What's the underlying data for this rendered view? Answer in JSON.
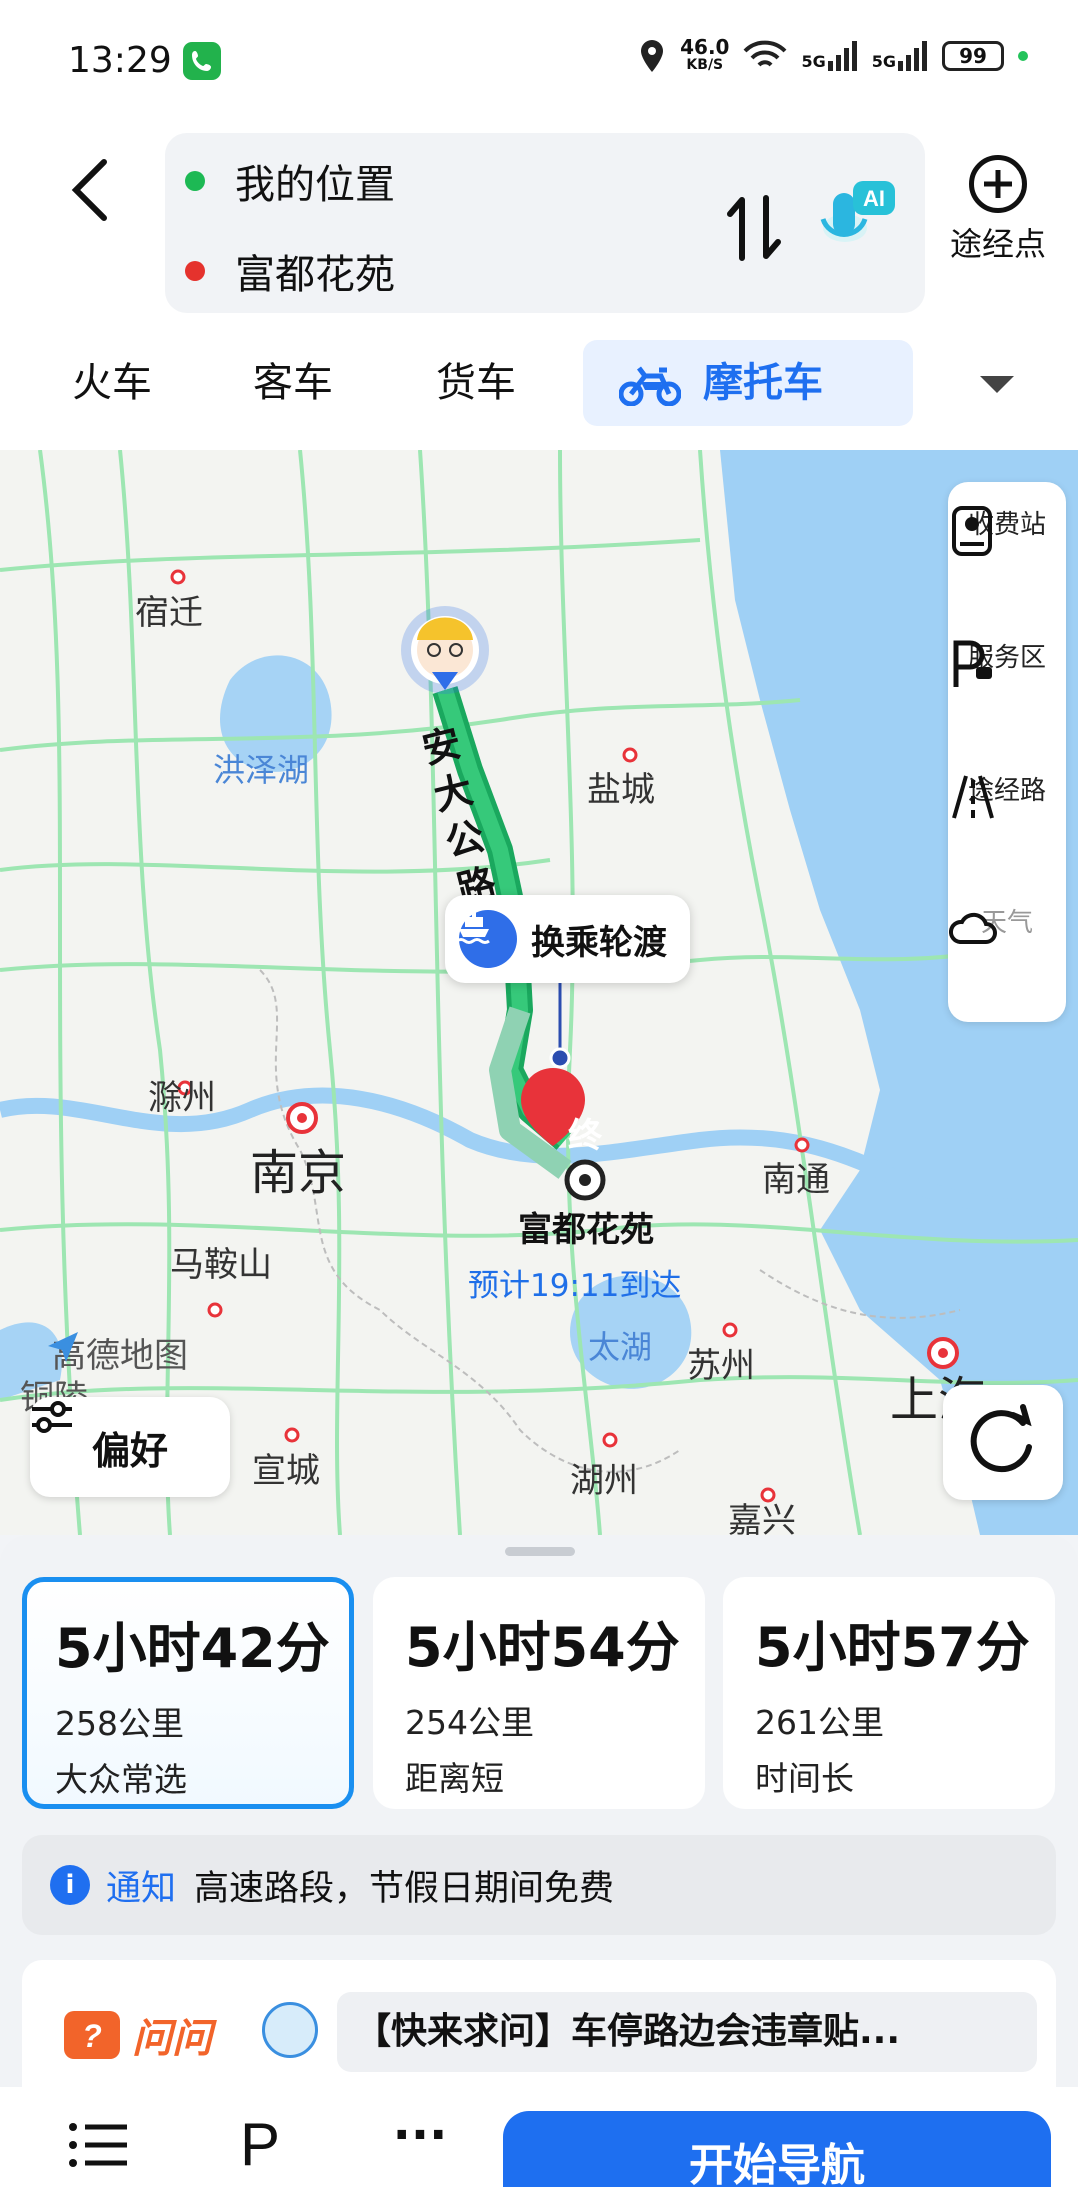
{
  "status_bar": {
    "time": "13:29",
    "net_speed": "46.0",
    "net_unit": "KB/S",
    "signal1": "5G",
    "signal2": "5G",
    "battery": "99"
  },
  "route": {
    "origin": "我的位置",
    "destination": "富都花苑",
    "origin_color": "#1db954",
    "destination_color": "#e5322d",
    "ai_label": "AI",
    "waypoint_label": "途经点"
  },
  "modes": {
    "train": "火车",
    "bus": "客车",
    "truck": "货车",
    "moto": "摩托车"
  },
  "map": {
    "cities": {
      "suqian": "宿迁",
      "yancheng": "盐城",
      "chuzhou": "滁州",
      "nanjing": "南京",
      "nantong": "南通",
      "maanshan": "马鞍山",
      "suzhou": "苏州",
      "shanghai": "上海",
      "xuancheng": "宣城",
      "huzhou": "湖州",
      "jiaxing": "嘉兴",
      "tongling": "铜陵"
    },
    "lakes": {
      "hongze": "洪泽湖",
      "taihu": "太湖"
    },
    "road_name": "安大公路",
    "ferry_label": "换乘轮渡",
    "end_marker": "终",
    "destination_name": "富都花苑",
    "eta": "预计19:11到达",
    "logo": "高德地图",
    "preference": "偏好",
    "side_panel": [
      "收费站",
      "服务区",
      "途经路",
      "天气"
    ]
  },
  "routes": [
    {
      "duration": "5小时42分",
      "distance": "258公里",
      "tag": "大众常选",
      "selected": true
    },
    {
      "duration": "5小时54分",
      "distance": "254公里",
      "tag": "距离短",
      "selected": false
    },
    {
      "duration": "5小时57分",
      "distance": "261公里",
      "tag": "时间长",
      "selected": false
    }
  ],
  "notice": {
    "label": "通知",
    "text": "高速路段，节假日期间免费"
  },
  "ask": {
    "label": "问问",
    "question": "【快来求问】车停路边会违章贴..."
  },
  "bottom": {
    "parking": "P",
    "more": "···",
    "start": "开始导航"
  }
}
